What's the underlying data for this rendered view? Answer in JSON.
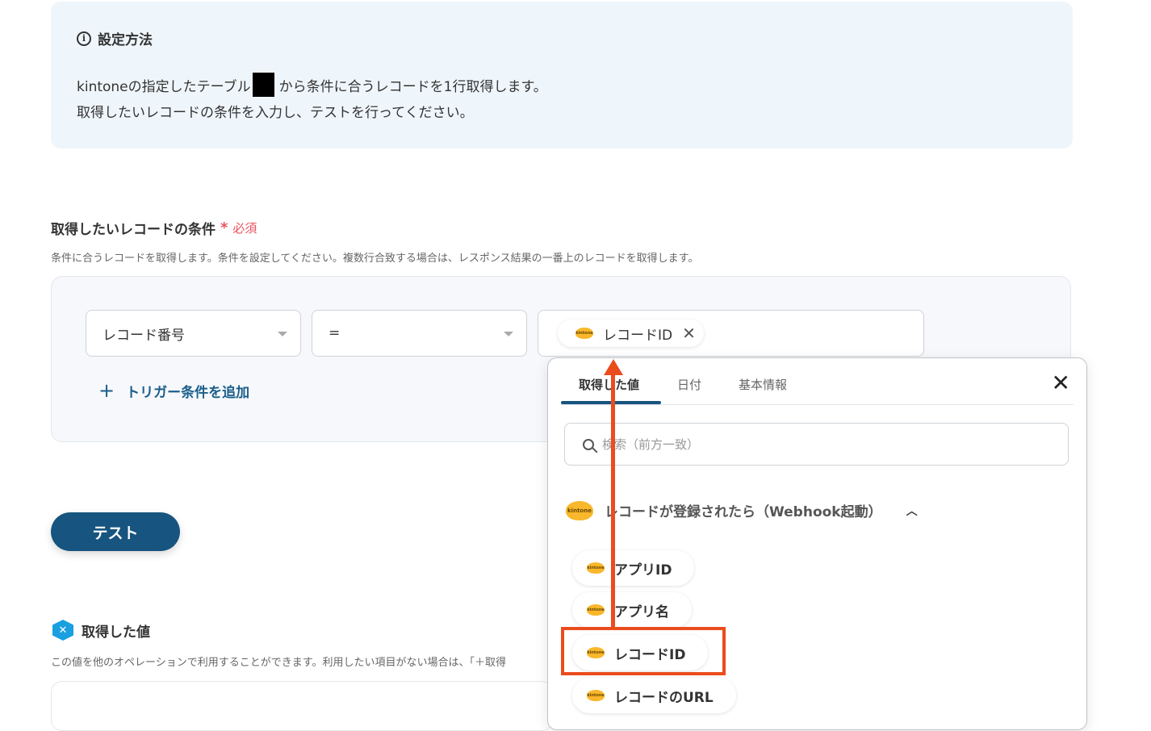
{
  "info": {
    "title": "設定方法",
    "line1_a": "kintoneの指定したテーブル",
    "line1_b": "から条件に合うレコードを1行取得します。",
    "line2": "取得したいレコードの条件を入力し、テストを行ってください。"
  },
  "condition": {
    "title": "取得したいレコードの条件",
    "required_mark": "*",
    "required_label": "必須",
    "description": "条件に合うレコードを取得します。条件を設定してください。複数行合致する場合は、レスポンス結果の一番上のレコードを取得します。",
    "field_select": "レコード番号",
    "operator_select": "=",
    "value_chip": "レコードID",
    "add_trigger": "トリガー条件を追加"
  },
  "test_button": "テスト",
  "got_values": {
    "title": "取得した値",
    "description": "この値を他のオペレーションで利用することができます。利用したい項目がない場合は、「＋取得"
  },
  "popup": {
    "tabs": [
      "取得した値",
      "日付",
      "基本情報"
    ],
    "search_placeholder": "検索（前方一致）",
    "group_title": "レコードが登録されたら（Webhook起動）",
    "items": [
      "アプリID",
      "アプリ名",
      "レコードID",
      "レコードのURL"
    ]
  },
  "icons": {
    "kintone_logo_text": "kintone",
    "accent_color": "#17547f",
    "annotation_color": "#ea4c1d"
  }
}
